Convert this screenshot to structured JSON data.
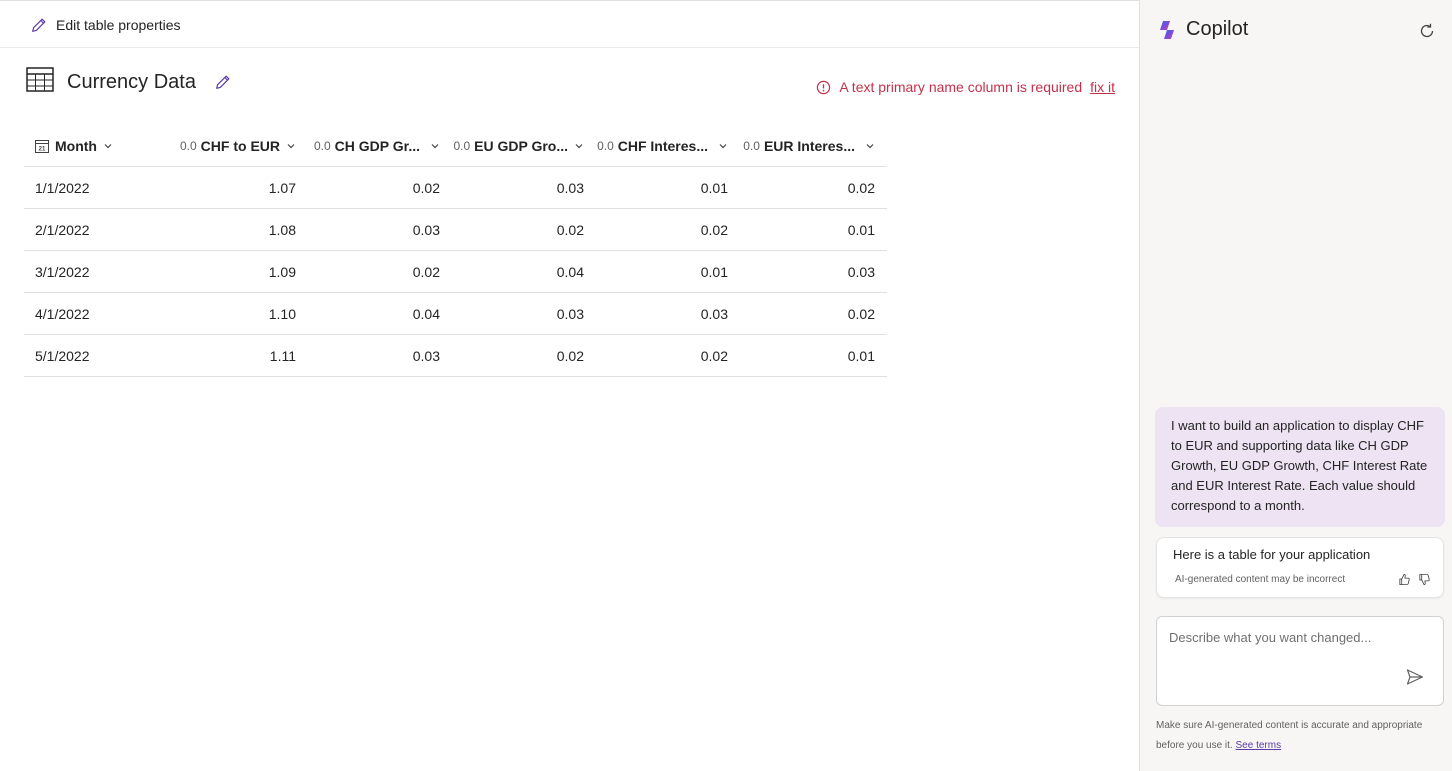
{
  "toolbar": {
    "edit_table_label": "Edit table properties"
  },
  "table": {
    "title": "Currency Data",
    "warning_text": "A text primary name column is required",
    "warning_link": "fix it",
    "columns": [
      {
        "label": "Month",
        "type_glyph": "21"
      },
      {
        "label": "CHF to EUR",
        "type_glyph": "0.0"
      },
      {
        "label": "CH GDP Gr...",
        "type_glyph": "0.0"
      },
      {
        "label": "EU GDP Gro...",
        "type_glyph": "0.0"
      },
      {
        "label": "CHF Interes...",
        "type_glyph": "0.0"
      },
      {
        "label": "EUR Interes...",
        "type_glyph": "0.0"
      }
    ],
    "rows": [
      [
        "1/1/2022",
        "1.07",
        "0.02",
        "0.03",
        "0.01",
        "0.02"
      ],
      [
        "2/1/2022",
        "1.08",
        "0.03",
        "0.02",
        "0.02",
        "0.01"
      ],
      [
        "3/1/2022",
        "1.09",
        "0.02",
        "0.04",
        "0.01",
        "0.03"
      ],
      [
        "4/1/2022",
        "1.10",
        "0.04",
        "0.03",
        "0.03",
        "0.02"
      ],
      [
        "5/1/2022",
        "1.11",
        "0.03",
        "0.02",
        "0.02",
        "0.01"
      ]
    ]
  },
  "copilot": {
    "title": "Copilot",
    "user_message": "I want to build an application to display CHF to EUR and supporting data like CH GDP Growth, EU GDP Growth, CHF Interest Rate and EUR Interest Rate. Each value should correspond to a month.",
    "bot_message": "Here is a table for your application",
    "ai_note": "AI-generated content may be incorrect",
    "input_placeholder": "Describe what you want changed...",
    "footer_text": "Make sure AI-generated content is accurate and appropriate before you use it.",
    "footer_link": "See terms"
  },
  "colors": {
    "accent": "#5b3aa8",
    "error": "#c4314b",
    "user_bubble": "#ede3f3",
    "panel_bg": "#f7f6f5"
  },
  "icons": [
    "pencil-icon",
    "table-icon",
    "error-circle-icon",
    "calendar-icon",
    "chevron-down-icon",
    "copilot-logo-icon",
    "refresh-icon",
    "thumbs-up-icon",
    "thumbs-down-icon",
    "send-icon"
  ]
}
